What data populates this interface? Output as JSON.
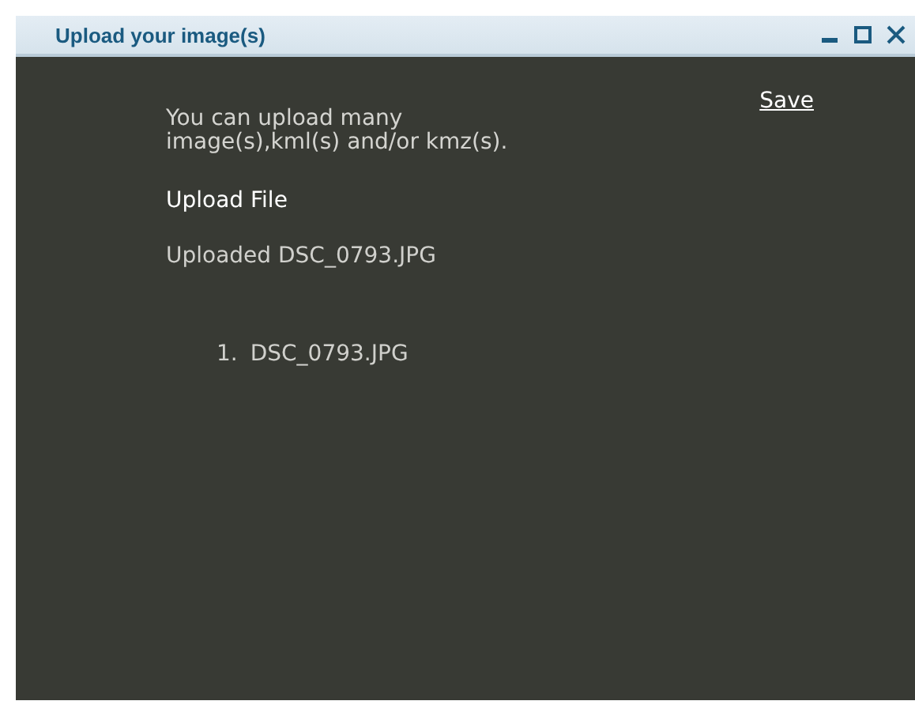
{
  "window": {
    "title": "Upload your image(s)",
    "controls": [
      {
        "kind": "minimize"
      },
      {
        "kind": "maximize"
      },
      {
        "kind": "close"
      }
    ]
  },
  "save_link": "Save",
  "description": "You can upload many image(s),kml(s) and/or kmz(s).",
  "upload_link": "Upload File",
  "status": "Uploaded DSC_0793.JPG",
  "files": [
    {
      "number": "1.",
      "name": "DSC_0793.JPG"
    }
  ]
}
